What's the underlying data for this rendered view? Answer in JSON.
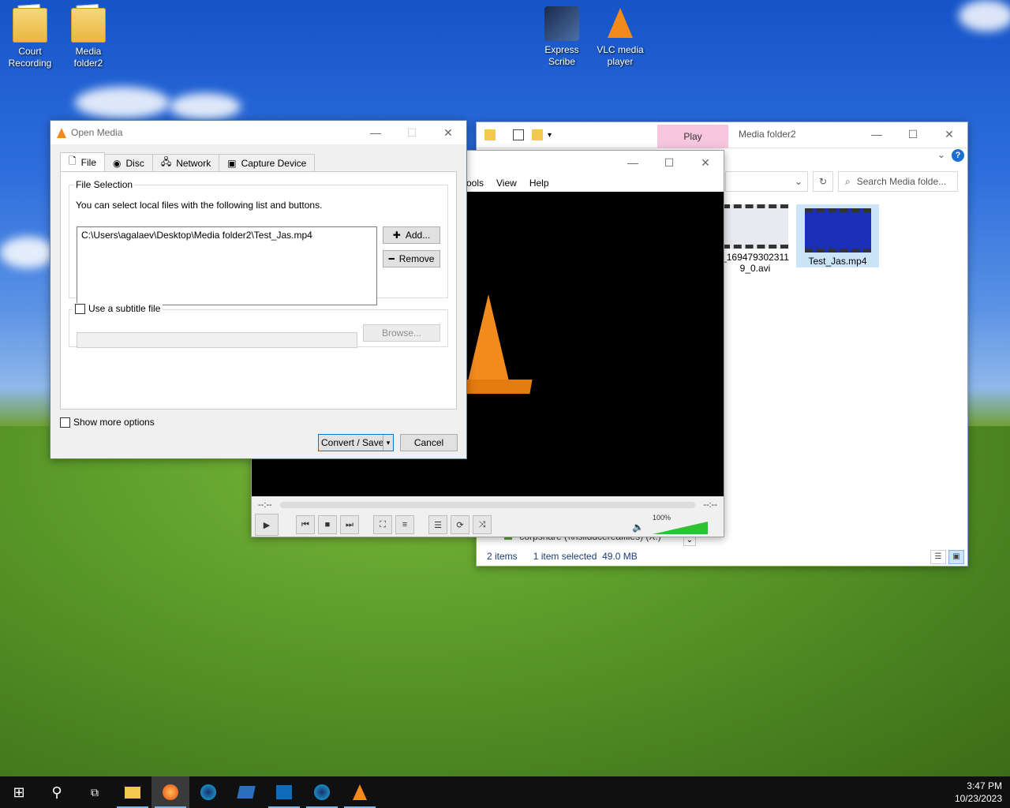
{
  "desktop": {
    "icons": [
      {
        "label1": "Court",
        "label2": "Recording"
      },
      {
        "label1": "Media",
        "label2": "folder2"
      },
      {
        "label1": "Express",
        "label2": "Scribe"
      },
      {
        "label1": "VLC media",
        "label2": "player"
      }
    ]
  },
  "explorer": {
    "title": "Media folder2",
    "play_tab": "Play",
    "search_placeholder": "Search Media folde...",
    "files": [
      {
        "name1": "_169479302311",
        "name2": "9_0.avi"
      },
      {
        "name1": "Test_Jas.mp4",
        "name2": ""
      }
    ],
    "status_items": "2 items",
    "status_selected": "1 item selected  49.0 MB",
    "nav_partial": "corpshare (\\\\hsilddcerealfiles) (X:)"
  },
  "vlc": {
    "menu": [
      "Tools",
      "View",
      "Help"
    ],
    "menu_partial_tools": "ools",
    "time_left": "--:--",
    "time_right": "--:--",
    "volume": "100%",
    "volume_level": 1.0
  },
  "open_media": {
    "title": "Open Media",
    "tabs": [
      "File",
      "Disc",
      "Network",
      "Capture Device"
    ],
    "file_selection_title": "File Selection",
    "file_selection_desc": "You can select local files with the following list and buttons.",
    "file_path": "C:\\Users\\agalaev\\Desktop\\Media folder2\\Test_Jas.mp4",
    "add_label": "Add...",
    "remove_label": "Remove",
    "subtitle_label": "Use a subtitle file",
    "browse_label": "Browse...",
    "show_more_label": "Show more options",
    "convert_label": "Convert / Save",
    "cancel_label": "Cancel"
  },
  "taskbar": {
    "time": "3:47 PM",
    "date": "10/23/2023"
  }
}
